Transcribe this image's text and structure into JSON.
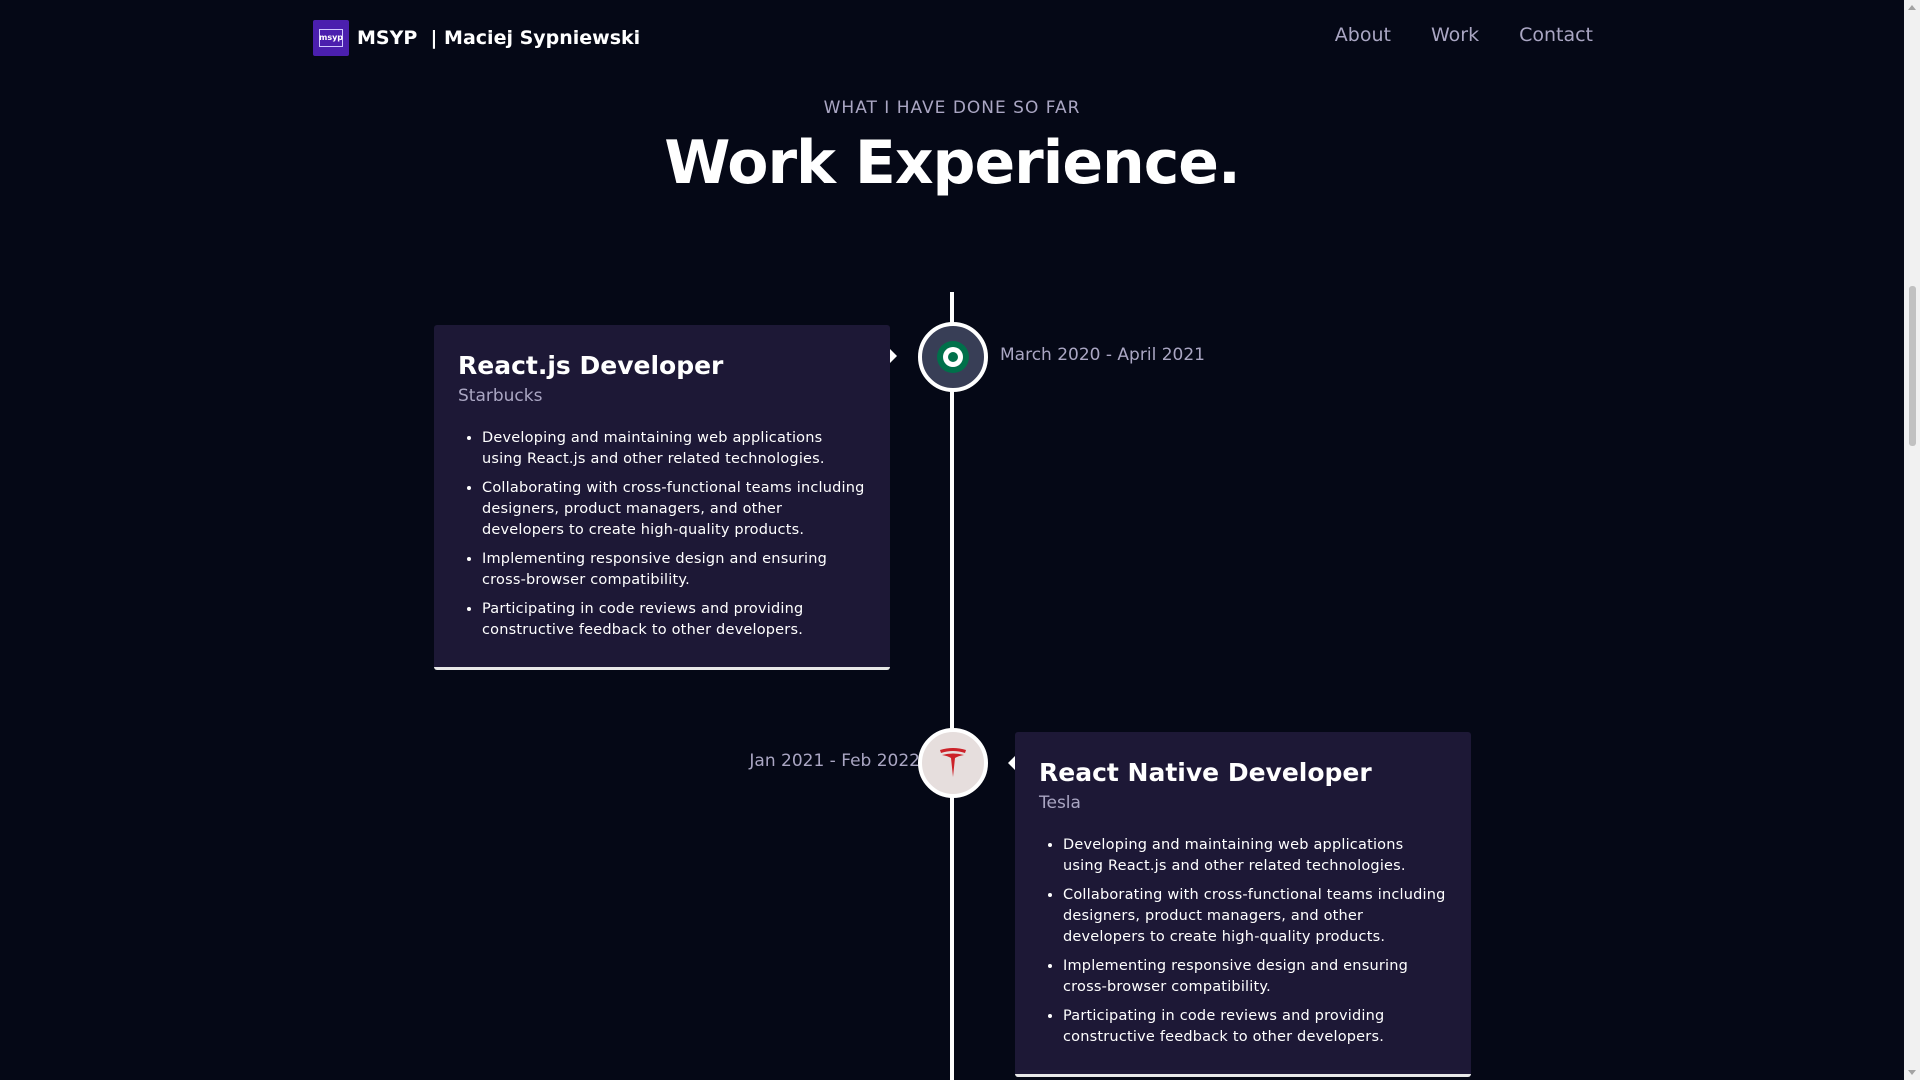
{
  "nav": {
    "logo_text": "msyp",
    "brand": "MSYP  | Maciej Sypniewski",
    "links": [
      "About",
      "Work",
      "Contact"
    ]
  },
  "section": {
    "subtitle": "WHAT I HAVE DONE SO FAR",
    "title": "Work Experience."
  },
  "experiences": [
    {
      "title": "React.js Developer",
      "company": "Starbucks",
      "date": "March 2020 - April 2021",
      "icon": "starbucks-logo-icon",
      "points": [
        "Developing and maintaining web applications using React.js and other related technologies.",
        "Collaborating with cross-functional teams including designers, product managers, and other developers to create high-quality products.",
        "Implementing responsive design and ensuring cross-browser compatibility.",
        "Participating in code reviews and providing constructive feedback to other developers."
      ]
    },
    {
      "title": "React Native Developer",
      "company": "Tesla",
      "date": "Jan 2021 - Feb 2022",
      "icon": "tesla-logo-icon",
      "points": [
        "Developing and maintaining web applications using React.js and other related technologies.",
        "Collaborating with cross-functional teams including designers, product managers, and other developers to create high-quality products.",
        "Implementing responsive design and ensuring cross-browser compatibility.",
        "Participating in code reviews and providing constructive feedback to other developers."
      ]
    }
  ],
  "colors": {
    "background": "#050816",
    "card": "#1d1836",
    "secondary_text": "#aaa6c3",
    "logo_bg": "#4b1fae",
    "starbucks_icon_bg": "#383e56",
    "tesla_icon_bg": "#e6dedd",
    "tesla_red": "#cc2229",
    "starbucks_green": "#00704a"
  }
}
